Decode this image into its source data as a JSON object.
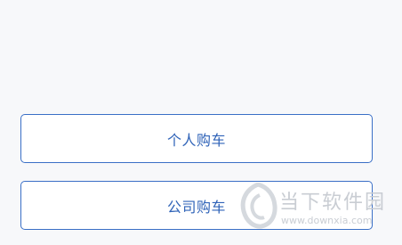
{
  "options": {
    "personal_label": "个人购车",
    "company_label": "公司购车"
  },
  "watermark": {
    "title": "当下软件园",
    "url": "www.downxia.com",
    "icon": "downxia-logo-icon"
  },
  "colors": {
    "background": "#f7f8fa",
    "accent_border": "#3a6fc6",
    "accent_text": "#2f63b8",
    "watermark": "#c9cdd3"
  }
}
